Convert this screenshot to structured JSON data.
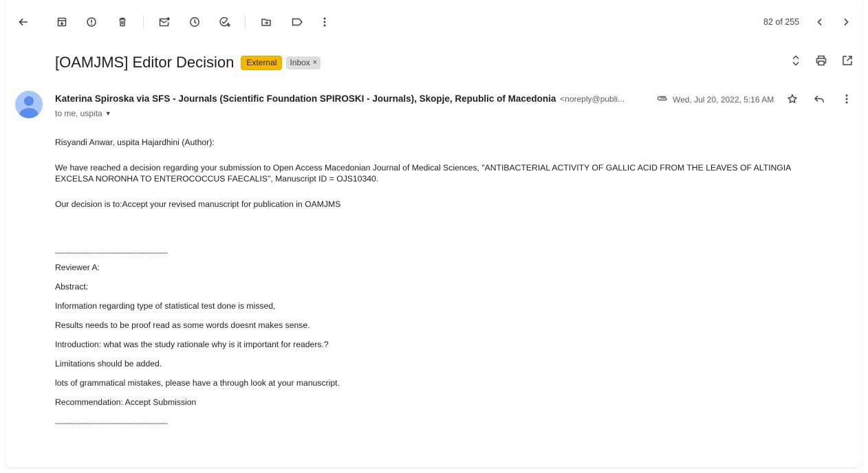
{
  "toolbar": {
    "back": "arrow-left-icon",
    "icons": [
      "archive-icon",
      "report-spam-icon",
      "delete-icon",
      "mark-unread-icon",
      "snooze-icon",
      "add-to-tasks-icon",
      "move-to-icon",
      "label-icon",
      "more-icon"
    ],
    "pager": "82 of 255"
  },
  "subject": {
    "title": "[OAMJMS] Editor Decision",
    "external_badge": "External",
    "inbox_label": "Inbox",
    "inbox_close": "×"
  },
  "message": {
    "sender": "Katerina Spiroska via SFS - Journals (Scientific Foundation SPIROSKI - Journals), Skopje, Republic of Macedonia",
    "sender_email": "<noreply@publi...",
    "date": "Wed, Jul 20, 2022, 5:16 AM",
    "to": "to me, uspita"
  },
  "body": {
    "greeting": "Risyandi Anwar, uspita Hajardhini (Author):",
    "p1_line1": "We have reached a decision regarding your submission to Open Access Macedonian Journal of Medical Sciences, \"ANTIBACTERIAL ACTIVITY OF GALLIC ACID FROM THE LEAVES OF ALTINGIA",
    "p1_line2": "EXCELSA NORONHA TO ENTEROCOCCUS FAECALIS\", Manuscript ID = OJS10340.",
    "decision": "Our decision is to:Accept your revised manuscript for publication in OAMJMS",
    "divider": "------------------------------------------------------",
    "reviewer": "Reviewer A:",
    "abstract": "Abstract:",
    "r1": "Information regarding type of statistical test done is missed,",
    "r2": "Results needs to be proof read as some words doesnt makes sense.",
    "r3": "Introduction: what was the study rationale why is it important for readers.?",
    "r4": "Limitations should be added.",
    "r5": "lots of grammatical mistakes, please have a through look at your manuscript.",
    "r6": "Recommendation: Accept Submission",
    "divider2": "------------------------------------------------------"
  },
  "colors": {
    "external_badge": "#f6b700",
    "avatar": "#a8c7fa",
    "icon": "#444746"
  }
}
